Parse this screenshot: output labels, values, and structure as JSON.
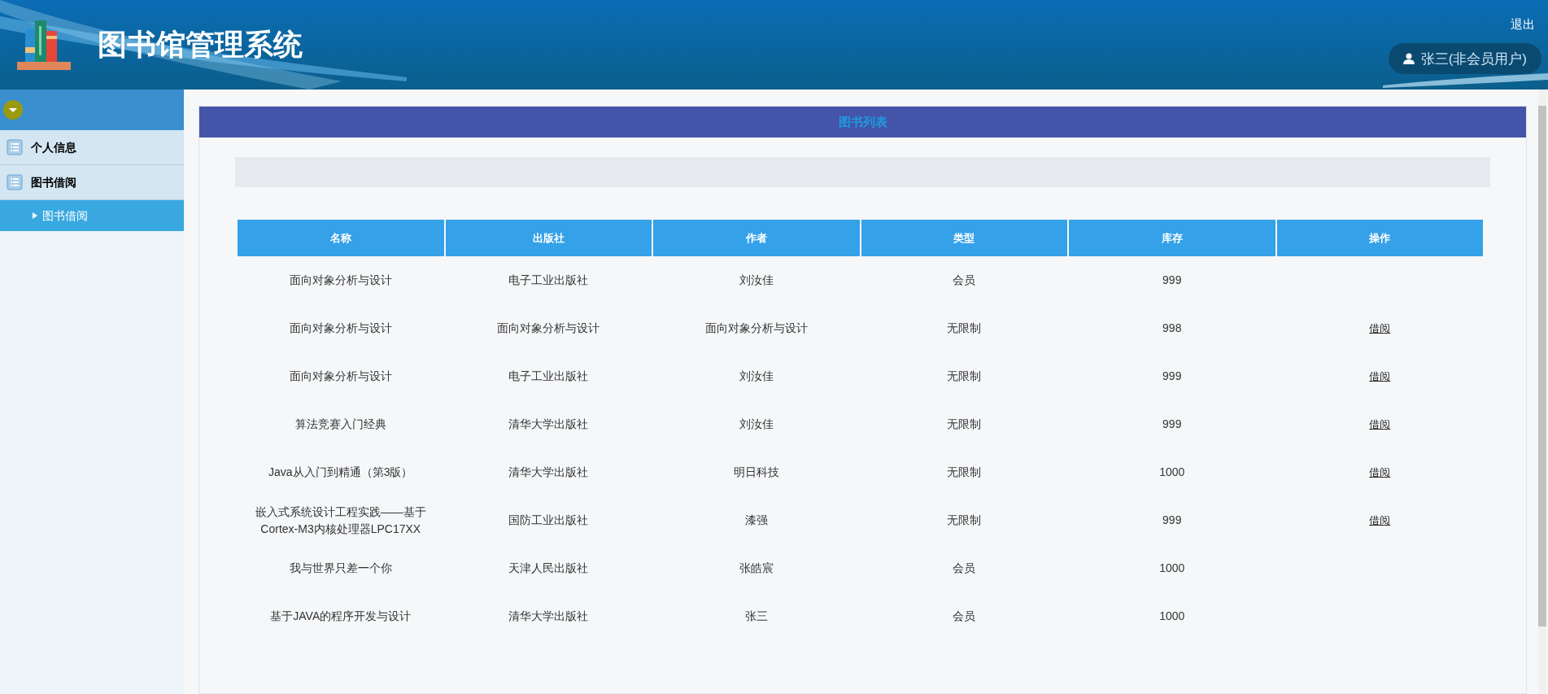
{
  "header": {
    "title": "图书馆管理系统",
    "logout": "退出",
    "user": "张三(非会员用户)"
  },
  "sidebar": {
    "items": [
      {
        "label": "个人信息"
      },
      {
        "label": "图书借阅",
        "children": [
          {
            "label": "图书借阅",
            "selected": true
          }
        ]
      }
    ]
  },
  "panel": {
    "title": "图书列表"
  },
  "table": {
    "columns": [
      "名称",
      "出版社",
      "作者",
      "类型",
      "库存",
      "操作"
    ],
    "rows": [
      {
        "cells": [
          "面向对象分析与设计",
          "电子工业出版社",
          "刘汝佳",
          "会员",
          "999"
        ]
      },
      {
        "cells": [
          "面向对象分析与设计",
          "面向对象分析与设计",
          "面向对象分析与设计",
          "无限制",
          "998"
        ],
        "action": "借阅"
      },
      {
        "cells": [
          "面向对象分析与设计",
          "电子工业出版社",
          "刘汝佳",
          "无限制",
          "999"
        ],
        "action": "借阅"
      },
      {
        "cells": [
          "算法竞赛入门经典",
          "清华大学出版社",
          "刘汝佳",
          "无限制",
          "999"
        ],
        "action": "借阅"
      },
      {
        "cells": [
          "Java从入门到精通（第3版）",
          "清华大学出版社",
          "明日科技",
          "无限制",
          "1000"
        ],
        "action": "借阅"
      },
      {
        "cells": [
          "嵌入式系统设计工程实践——基于Cortex-M3内核处理器LPC17XX",
          "国防工业出版社",
          "漆强",
          "无限制",
          "999"
        ],
        "action": "借阅"
      },
      {
        "cells": [
          "我与世界只差一个你",
          "天津人民出版社",
          "张皓宸",
          "会员",
          "1000"
        ]
      },
      {
        "cells": [
          "基于JAVA的程序开发与设计",
          "清华大学出版社",
          "张三",
          "会员",
          "1000"
        ]
      }
    ]
  }
}
